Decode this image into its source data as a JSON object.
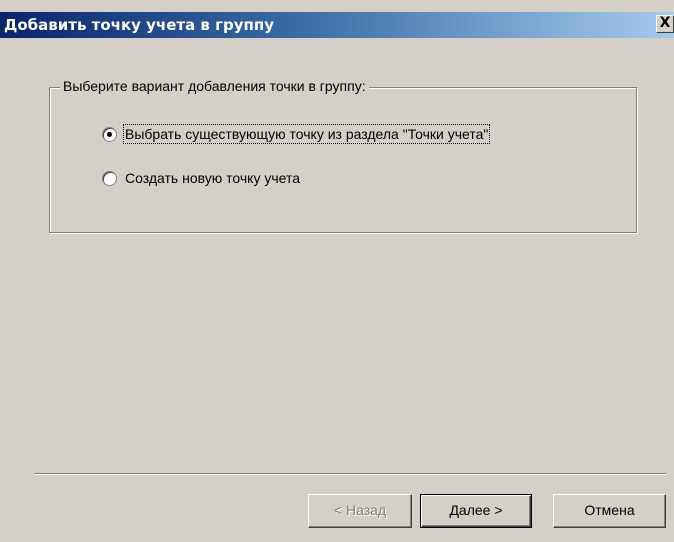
{
  "window": {
    "title": "Добавить точку учета в группу",
    "close_glyph": "X"
  },
  "group": {
    "legend": "Выберите вариант добавления точки в группу:",
    "options": [
      {
        "label": "Выбрать существующую точку из раздела \"Точки учета\"",
        "checked": true
      },
      {
        "label": "Создать новую точку учета",
        "checked": false
      }
    ]
  },
  "buttons": {
    "back_label": "< Назад",
    "next_label": "Далее >",
    "cancel_label": "Отмена"
  }
}
